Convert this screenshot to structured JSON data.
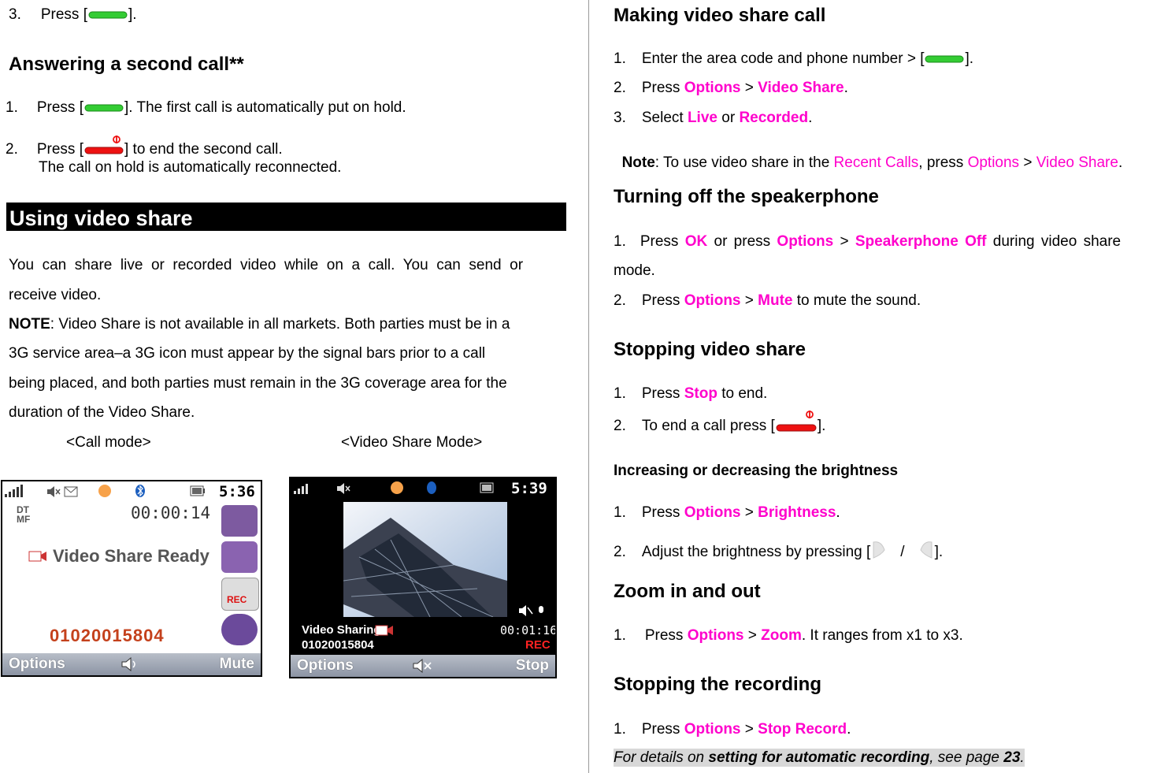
{
  "left": {
    "step3": {
      "num": "3.",
      "pre": "Press [",
      "post": "]."
    },
    "heading_second_call": "Answering a second call**",
    "second_call_steps": [
      {
        "num": "1.",
        "pre": "Press [",
        "post": "]. The first call is automatically put on hold."
      },
      {
        "num": "2.",
        "pre": "Press [",
        "post": "] to end the second call."
      }
    ],
    "reconnect_text": "The call on hold is automatically reconnected.",
    "section_title": "Using video share",
    "para_line1": "You  can  share  live  or  recorded  video  while  on  a  call.  You  can  send  or",
    "para_line2": "receive video.",
    "note_label": "NOTE",
    "note_lines": [
      ": Video Share is not available in all markets. Both parties must be in a",
      "3G service area–a 3G icon must appear by the signal bars prior to a call",
      "being placed, and both parties must remain in the 3G coverage area for the",
      "duration of the Video Share."
    ],
    "caption_call_mode": "<Call mode>",
    "caption_video_mode": "<Video Share Mode>",
    "screen1": {
      "time": "5:36",
      "timer": "00:00:14",
      "dtmf": "DT MF",
      "status": "Video Share Ready",
      "number": "01020015804",
      "soft_left": "Options",
      "soft_right": "Mute"
    },
    "screen2": {
      "time": "5:39",
      "label": "Video Sharing",
      "timer": "00:01:16",
      "number": "01020015804",
      "rec": "REC",
      "soft_left": "Options",
      "soft_right": "Stop"
    }
  },
  "right": {
    "making_heading": "Making video share call",
    "making_steps": {
      "s1": {
        "num": "1.",
        "pre": "Enter the area code and phone number > [",
        "post": "]."
      },
      "s2": {
        "num": "2.",
        "pre": "Press ",
        "k1": "Options",
        "sep": " > ",
        "k2": "Video Share",
        "post": "."
      },
      "s3": {
        "num": "3.",
        "pre": "Select ",
        "k1": "Live",
        "sep": " or ",
        "k2": "Recorded",
        "post": "."
      }
    },
    "making_note": {
      "label": "Note",
      "pre": ": To use video share in the ",
      "k1": "Recent Calls",
      "mid": ", press ",
      "k2": "Options",
      "sep": " > ",
      "k3": "Video Share",
      "post": "."
    },
    "speaker_heading": "Turning off the speakerphone",
    "speaker_s1": {
      "num": "1.",
      "pre": "Press ",
      "k1": "OK",
      "mid": " or press ",
      "k2": "Options",
      "sep": " > ",
      "k3": "Speakerphone Off",
      "post": " during video share"
    },
    "speaker_s1_cont": "mode.",
    "speaker_s2": {
      "num": "2.",
      "pre": "Press ",
      "k1": "Options",
      "sep": " > ",
      "k2": "Mute",
      "post": " to mute the sound."
    },
    "stopping_heading": "Stopping video share",
    "stop_s1": {
      "num": "1.",
      "pre": "Press ",
      "k1": "Stop",
      "post": " to end."
    },
    "stop_s2": {
      "num": "2.",
      "pre": "To end a call press [",
      "post": "]."
    },
    "brightness_heading": "Increasing or decreasing the brightness",
    "bright_s1": {
      "num": "1.",
      "pre": "Press ",
      "k1": "Options",
      "sep": " > ",
      "k2": "Brightness",
      "post": "."
    },
    "bright_s2": {
      "num": "2.",
      "pre": "Adjust the brightness by pressing [",
      "slash": "/",
      "post": "]."
    },
    "zoom_heading": "Zoom in and out",
    "zoom_s1": {
      "num": "1.",
      "pre": "Press ",
      "k1": "Options",
      "sep": " > ",
      "k2": "Zoom",
      "post": ". It ranges from x1 to x3."
    },
    "rec_heading": "Stopping the recording",
    "rec_s1": {
      "num": "1.",
      "pre": "Press ",
      "k1": "Options",
      "sep": " > ",
      "k2": "Stop Record",
      "post": "."
    },
    "footer": {
      "pre": "For details on ",
      "bold": "setting for automatic recording",
      "mid": ", see page ",
      "page": "23",
      "post": "."
    }
  },
  "colors": {
    "keyword": "#ff00cc",
    "send_key": "#33cc33",
    "end_key": "#ee1111"
  }
}
